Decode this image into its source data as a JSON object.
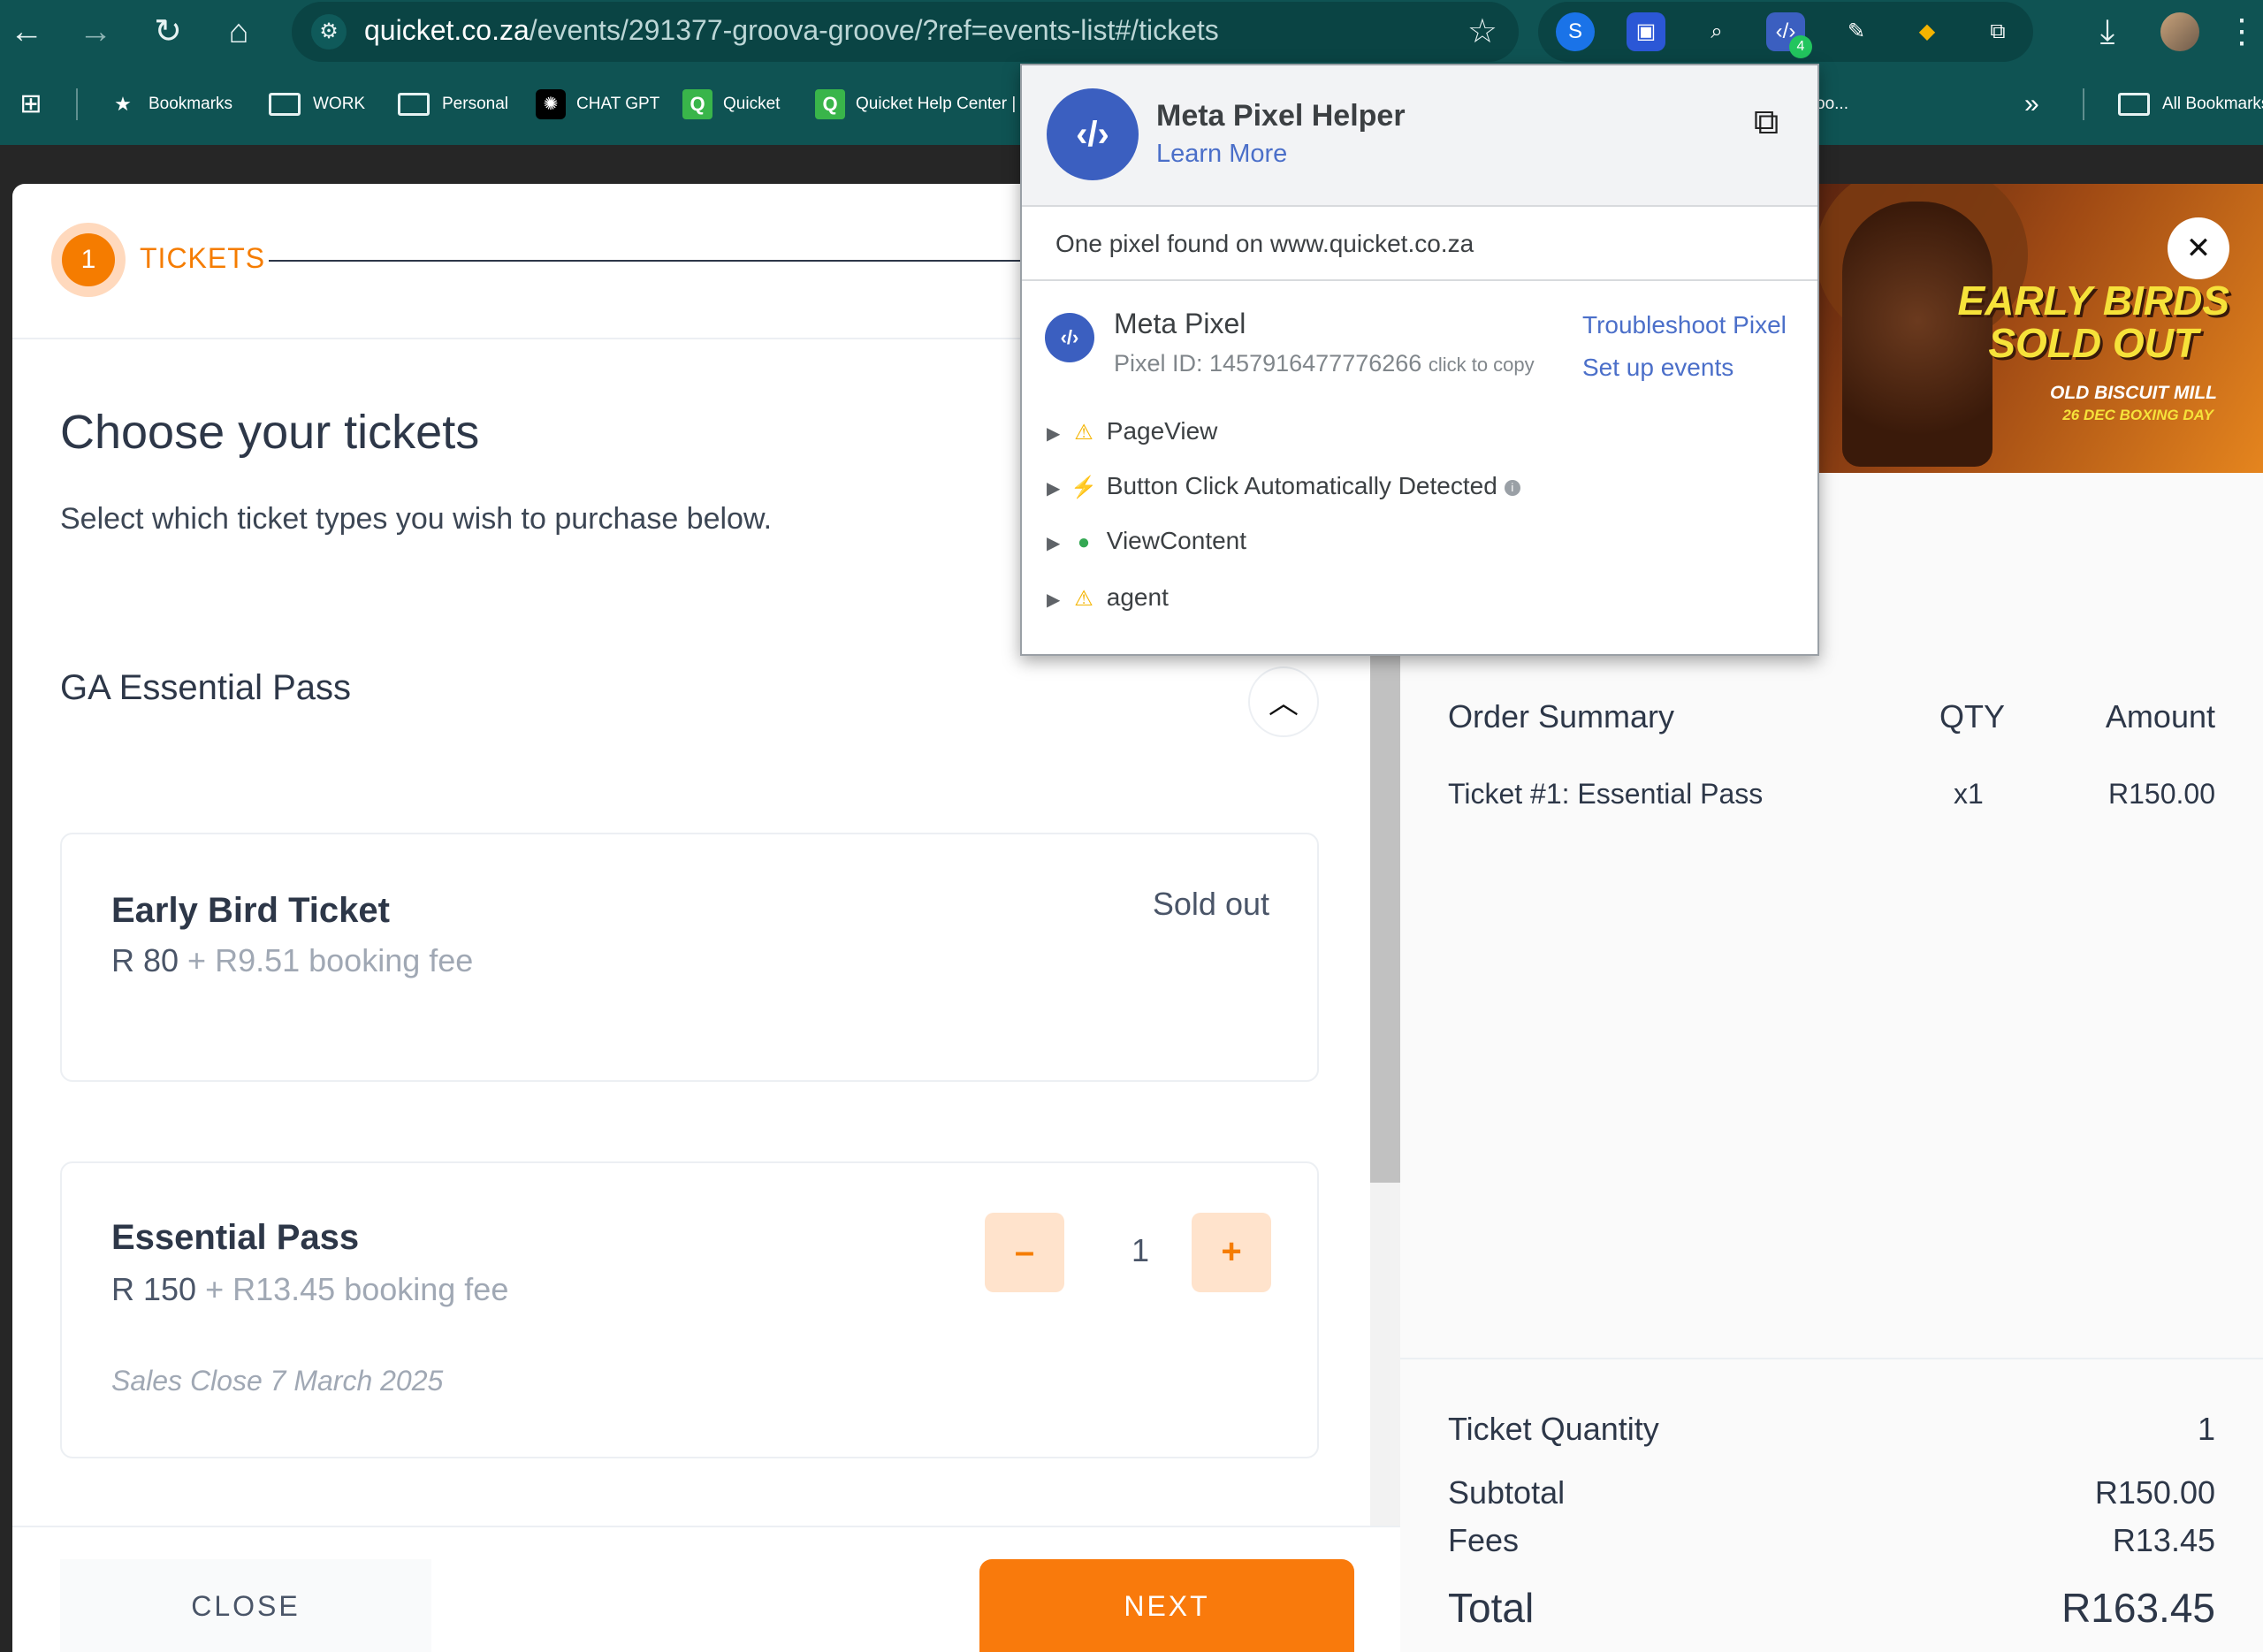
{
  "browser": {
    "url_host": "quicket.co.za",
    "url_path": "/events/291377-groova-groove/?ref=events-list#/tickets",
    "extension_badge": "4",
    "bookmarks": [
      {
        "label": "Bookmarks",
        "icon": "star-icon"
      },
      {
        "label": "WORK",
        "icon": "folder-icon"
      },
      {
        "label": "Personal",
        "icon": "folder-icon"
      },
      {
        "label": "CHAT GPT",
        "icon": "chatgpt-icon"
      },
      {
        "label": "Quicket",
        "icon": "quicket-icon"
      },
      {
        "label": "Quicket Help Center | K",
        "icon": "quicket-icon"
      }
    ],
    "bookmark_overflow_fragment": "oo...",
    "all_bookmarks": "All Bookmarks"
  },
  "stepper": {
    "number": "1",
    "label": "TICKETS"
  },
  "page": {
    "title": "Choose your tickets",
    "subtitle": "Select which ticket types you wish to purchase below.",
    "group_title": "GA Essential Pass"
  },
  "tickets": [
    {
      "name": "Early Bird Ticket",
      "price": "R 80",
      "fee": " + R9.51 booking fee",
      "status": "Sold out"
    },
    {
      "name": "Essential Pass",
      "price": "R 150",
      "fee": " + R13.45 booking fee",
      "quantity": "1",
      "sales_close": "Sales Close 7 March 2025",
      "minus": "–",
      "plus": "+"
    }
  ],
  "footer": {
    "close_label": "CLOSE",
    "next_label": "NEXT"
  },
  "banner": {
    "headline_1": "EARLY BIRDS",
    "headline_2": "SOLD OUT",
    "venue": "OLD BISCUIT MILL",
    "date": "26 DEC BOXING DAY"
  },
  "summary": {
    "col_item": "Order Summary",
    "col_qty": "QTY",
    "col_amount": "Amount",
    "line_item": "Ticket #1: Essential Pass",
    "line_qty": "x1",
    "line_amount": "R150.00",
    "ticket_qty_label": "Ticket Quantity",
    "ticket_qty_value": "1",
    "subtotal_label": "Subtotal",
    "subtotal_value": "R150.00",
    "fees_label": "Fees",
    "fees_value": "R13.45",
    "total_label": "Total",
    "total_value": "R163.45"
  },
  "pixel_helper": {
    "title": "Meta Pixel Helper",
    "learn_more": "Learn More",
    "found_text": "One pixel found on www.quicket.co.za",
    "pixel_name": "Meta Pixel",
    "pixel_id": "Pixel ID: 1457916477776266",
    "click_to_copy": "click to copy",
    "troubleshoot": "Troubleshoot Pixel",
    "setup_events": "Set up events",
    "events": [
      {
        "name": "PageView",
        "status": "warning"
      },
      {
        "name": "Button Click Automatically Detected",
        "status": "auto"
      },
      {
        "name": "ViewContent",
        "status": "success"
      },
      {
        "name": "agent",
        "status": "warning"
      }
    ]
  }
}
